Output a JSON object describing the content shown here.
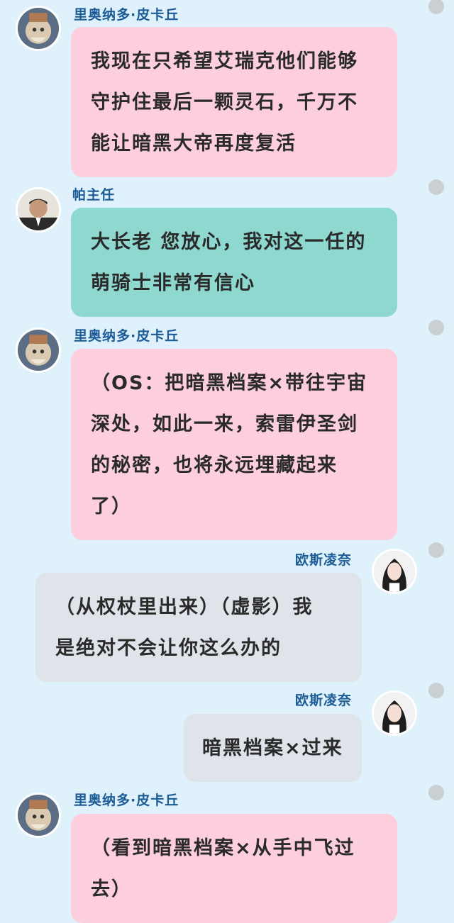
{
  "colors": {
    "background": "#dff1fb",
    "name_text": "#1b5b96",
    "bubble_pink": "#fdcfdc",
    "bubble_teal": "#8ed8d0",
    "bubble_grey": "#dfe3ea"
  },
  "messages": [
    {
      "sender": "里奥纳多·皮卡丘",
      "side": "left",
      "lines": [
        "我现在只希望艾瑞克他们能够",
        "守护住最后一颗灵石，千万不",
        "能让暗黑大帝再度复活"
      ]
    },
    {
      "sender": "帕主任",
      "side": "left",
      "lines": [
        "大长老 您放心，我对这一任的",
        "萌骑士非常有信心"
      ]
    },
    {
      "sender": "里奥纳多·皮卡丘",
      "side": "left",
      "lines": [
        "（OS：把暗黑档案×带往宇宙",
        "深处，如此一来，索雷伊圣剑",
        "的秘密，也将永远埋藏起来",
        "了）"
      ]
    },
    {
      "sender": "欧斯凌奈",
      "side": "right",
      "lines": [
        "（从权杖里出来）（虚影）我",
        "是绝对不会让你这么办的"
      ]
    },
    {
      "sender": "欧斯凌奈",
      "side": "right",
      "lines": [
        "暗黑档案×过来"
      ]
    },
    {
      "sender": "里奥纳多·皮卡丘",
      "side": "left",
      "lines": [
        "（看到暗黑档案×从手中飞过",
        "去）"
      ]
    }
  ]
}
